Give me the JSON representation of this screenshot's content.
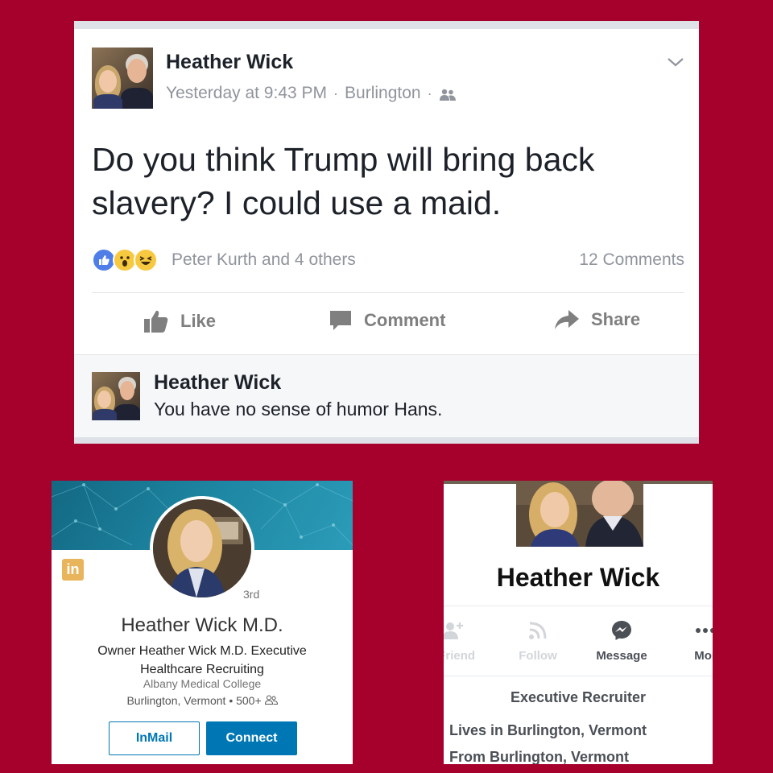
{
  "fb_post": {
    "author": "Heather Wick",
    "time": "Yesterday at 9:43 PM",
    "separator": "·",
    "location": "Burlington",
    "text": "Do you think Trump will bring back slavery?  I could use a maid.",
    "reactions": [
      "like-reaction-icon",
      "wow-reaction-icon",
      "haha-reaction-icon"
    ],
    "reaction_names": "Peter Kurth and 4 others",
    "comments_count": "12 Comments",
    "actions": {
      "like": "Like",
      "comment": "Comment",
      "share": "Share"
    },
    "comment": {
      "author": "Heather Wick",
      "text": "You have no sense of humor Hans."
    },
    "colors": {
      "text": "#1d2129",
      "meta": "#90949c",
      "background": "#a6002c"
    }
  },
  "linkedin": {
    "logo": "in",
    "degree": "3rd",
    "name": "Heather Wick M.D.",
    "headline": "Owner Heather Wick M.D. Executive Healthcare Recruiting",
    "school": "Albany Medical College",
    "location": "Burlington, Vermont",
    "connections": "500+",
    "inmail_label": "InMail",
    "connect_label": "Connect",
    "colors": {
      "brand": "#0077b5",
      "logo": "#e8b55d"
    }
  },
  "fb_profile": {
    "name": "Heather Wick",
    "actions": {
      "add_friend": "l Friend",
      "follow": "Follow",
      "message": "Message",
      "more": "Mor"
    },
    "work": "Executive Recruiter",
    "lives": "Lives in Burlington, Vermont",
    "from": "From Burlington, Vermont"
  }
}
